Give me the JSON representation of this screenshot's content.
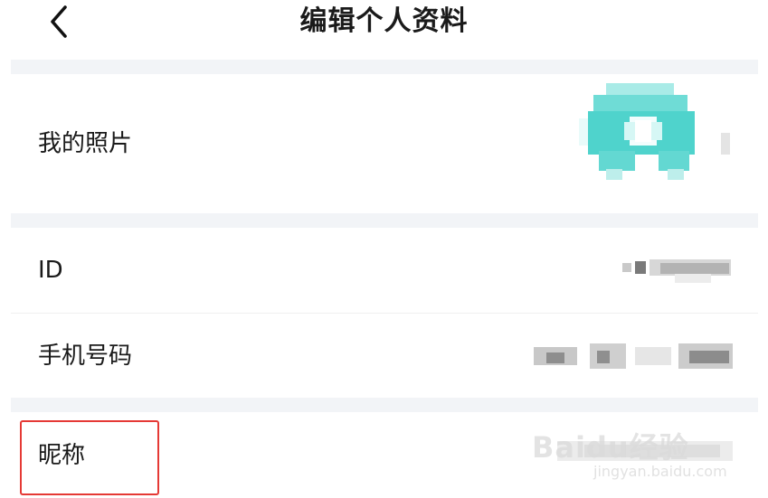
{
  "header": {
    "title": "编辑个人资料",
    "back_icon": "chevron-left-icon"
  },
  "rows": {
    "photo": {
      "label": "我的照片"
    },
    "id": {
      "label": "ID"
    },
    "phone": {
      "label": "手机号码"
    },
    "nickname": {
      "label": "昵称"
    }
  },
  "watermark": {
    "text": "Baidu经验",
    "sub": "jingyan.baidu.com"
  },
  "colors": {
    "avatar": "#4fd3cc",
    "band": "#f2f4f7",
    "highlight": "#e53935",
    "watermark": "#e2e2e2"
  }
}
